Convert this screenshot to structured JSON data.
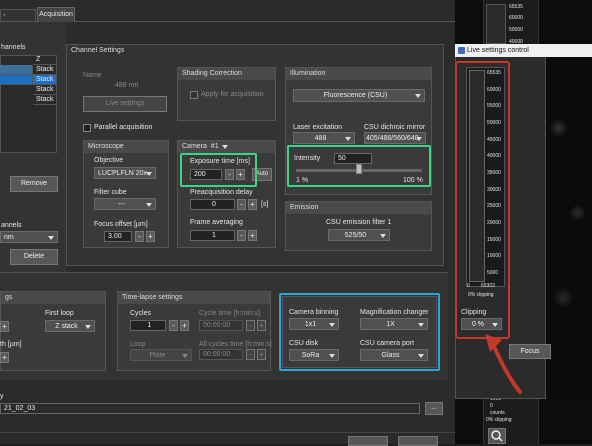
{
  "tabs": {
    "autofocus": "-Autofocus",
    "acquisition": "Acquisition"
  },
  "left": {
    "channels_header": "hannels",
    "table_col": "Z",
    "rows": [
      "Stack",
      "Stack",
      "Stack",
      "Stack"
    ],
    "remove": "Remove",
    "channels_label": "annels",
    "nm_value": "nm",
    "delete": "Delete",
    "gs_label": "gs",
    "th_label": "th [µm]",
    "date_value": "21_02_03"
  },
  "channel_settings": {
    "title": "Channel Settings",
    "name_label": "Name",
    "name_value": "488 nm",
    "live_settings": "Live settings",
    "parallel": "Parallel acquisition"
  },
  "shading": {
    "title": "Shading Correction",
    "apply": "Apply for acquisition"
  },
  "illumination": {
    "title": "Illumination",
    "mode": "Fluorescence (CSU)",
    "laser_label": "Laser excitation",
    "laser_value": "488",
    "mirror_label": "CSU dichroic mirror",
    "mirror_value": "405/488/560/640",
    "intensity_label": "Intensity",
    "intensity_value": "50",
    "intensity_fraction": 0.5,
    "min": "1 %",
    "max": "100 %"
  },
  "microscope": {
    "title": "Microscope",
    "objective_label": "Objective",
    "objective_value": "LUCPLFLN 20x",
    "filter_label": "Filter cube",
    "filter_value": "---",
    "focus_label": "Focus offset [µm]",
    "focus_value": "3.00"
  },
  "camera": {
    "tab": "Camera",
    "tab_num": "#1",
    "exposure_label": "Exposure time [ms]",
    "exposure_value": "200",
    "auto": "Auto",
    "predelay_label": "Preacquisition delay",
    "predelay_value": "0",
    "predelay_unit": "[s]",
    "avg_label": "Frame averaging",
    "avg_value": "1"
  },
  "emission": {
    "title": "Emission",
    "filter_label": "CSU emission filter 1",
    "filter_value": "525/50"
  },
  "loop": {
    "first_loop_label": "First loop",
    "first_loop_value": "Z stack"
  },
  "timelapse": {
    "title": "Time-lapse settings",
    "cycles_label": "Cycles",
    "cycles_value": "1",
    "cycle_time_label": "Cycle time [h:min:s]",
    "cycle_time_value": "00:00:00",
    "loop_label": "Loop",
    "loop_value": "Plate",
    "all_cycles_label": "All cycles time [h:min:s]",
    "all_cycles_value": "00:00:00"
  },
  "csu_panel": {
    "binning_label": "Camera binning",
    "binning_value": "1x1",
    "mag_label": "Magnification changer",
    "mag_value": "1X",
    "disk_label": "CSU disk",
    "disk_value": "SoRa",
    "port_label": "CSU camera port",
    "port_value": "Glass"
  },
  "live_window": {
    "title": "Live settings control",
    "scale": [
      "65535",
      "60000",
      "55000",
      "50000",
      "45000",
      "40000",
      "35000",
      "30000",
      "25000",
      "20000",
      "15000",
      "10000",
      "5000"
    ],
    "bottom_min": "0",
    "bottom_max": "65303",
    "clipping_pct": "0% clipping",
    "clipping_label": "Clipping",
    "clipping_value": "0 %",
    "focus": "Focus"
  },
  "bg_strip": {
    "top": [
      "65535",
      "60000",
      "50000",
      "40000"
    ],
    "bottom": [
      "1000",
      "0",
      "counts",
      "0% clipping"
    ]
  },
  "ellipsis": "..."
}
